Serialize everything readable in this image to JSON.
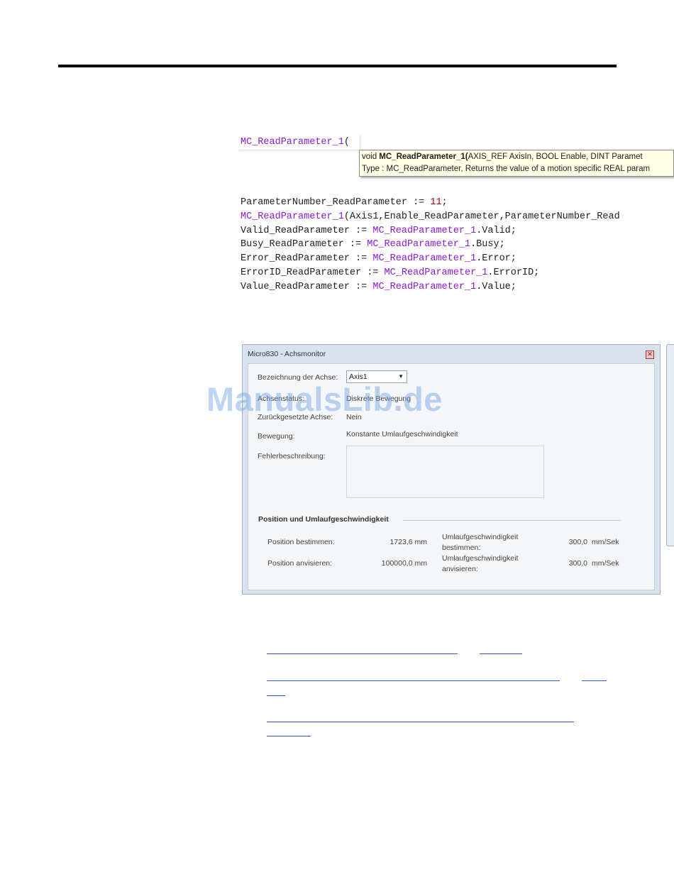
{
  "editor": {
    "call_prefix": "MC_ReadParameter_1",
    "call_paren": "(",
    "tooltip_line1": {
      "pre": "void ",
      "bold": "MC_ReadParameter_1(",
      "post": "AXIS_REF AxisIn, BOOL Enable, DINT Paramet"
    },
    "tooltip_line2": "Type : MC_ReadParameter, Returns the value of a motion specific REAL param",
    "lines": [
      {
        "a": "ParameterNumber_ReadParameter := ",
        "num": "11",
        "b": ";"
      },
      {
        "fb": "MC_ReadParameter_1",
        "rest": "(Axis1,Enable_ReadParameter,ParameterNumber_Read"
      },
      {
        "a": "Valid_ReadParameter := ",
        "fb": "MC_ReadParameter_1",
        "rest": ".Valid;"
      },
      {
        "a": "Busy_ReadParameter := ",
        "fb": "MC_ReadParameter_1",
        "rest": ".Busy;"
      },
      {
        "a": "Error_ReadParameter := ",
        "fb": "MC_ReadParameter_1",
        "rest": ".Error;"
      },
      {
        "a": "ErrorID_ReadParameter := ",
        "fb": "MC_ReadParameter_1",
        "rest": ".ErrorID;"
      },
      {
        "a": "Value_ReadParameter := ",
        "fb": "MC_ReadParameter_1",
        "rest": ".Value;"
      }
    ]
  },
  "dialog": {
    "title": "Micro830 - Achsmonitor",
    "close_glyph": "✕",
    "axis_label": "Bezeichnung der Achse:",
    "axis_value": "Axis1",
    "status_label": "Achsenstatus:",
    "status_value": "Diskrete Bewegung",
    "reset_label": "Zurückgesetzte Achse:",
    "reset_value": "Nein",
    "motion_label": "Bewegung:",
    "motion_value": "Konstante Umlaufgeschwindigkeit",
    "error_label": "Fehlerbeschreibung:",
    "group_title": "Position und Umlaufgeschwindigkeit",
    "pos_actual_label": "Position bestimmen:",
    "pos_actual_value": "1723,6 mm",
    "pos_target_label": "Position anvisieren:",
    "pos_target_value": "100000,0 mm",
    "vel_actual_label_1": "Umlaufgeschwindigkeit",
    "vel_actual_label_2": "bestimmen:",
    "vel_actual_value": "300,0",
    "vel_actual_unit": "mm/Sek",
    "vel_target_label_1": "Umlaufgeschwindigkeit",
    "vel_target_label_2": "anvisieren:",
    "vel_target_value": "300,0",
    "vel_target_unit": "mm/Sek"
  },
  "watermark": "ManualsLib.de"
}
